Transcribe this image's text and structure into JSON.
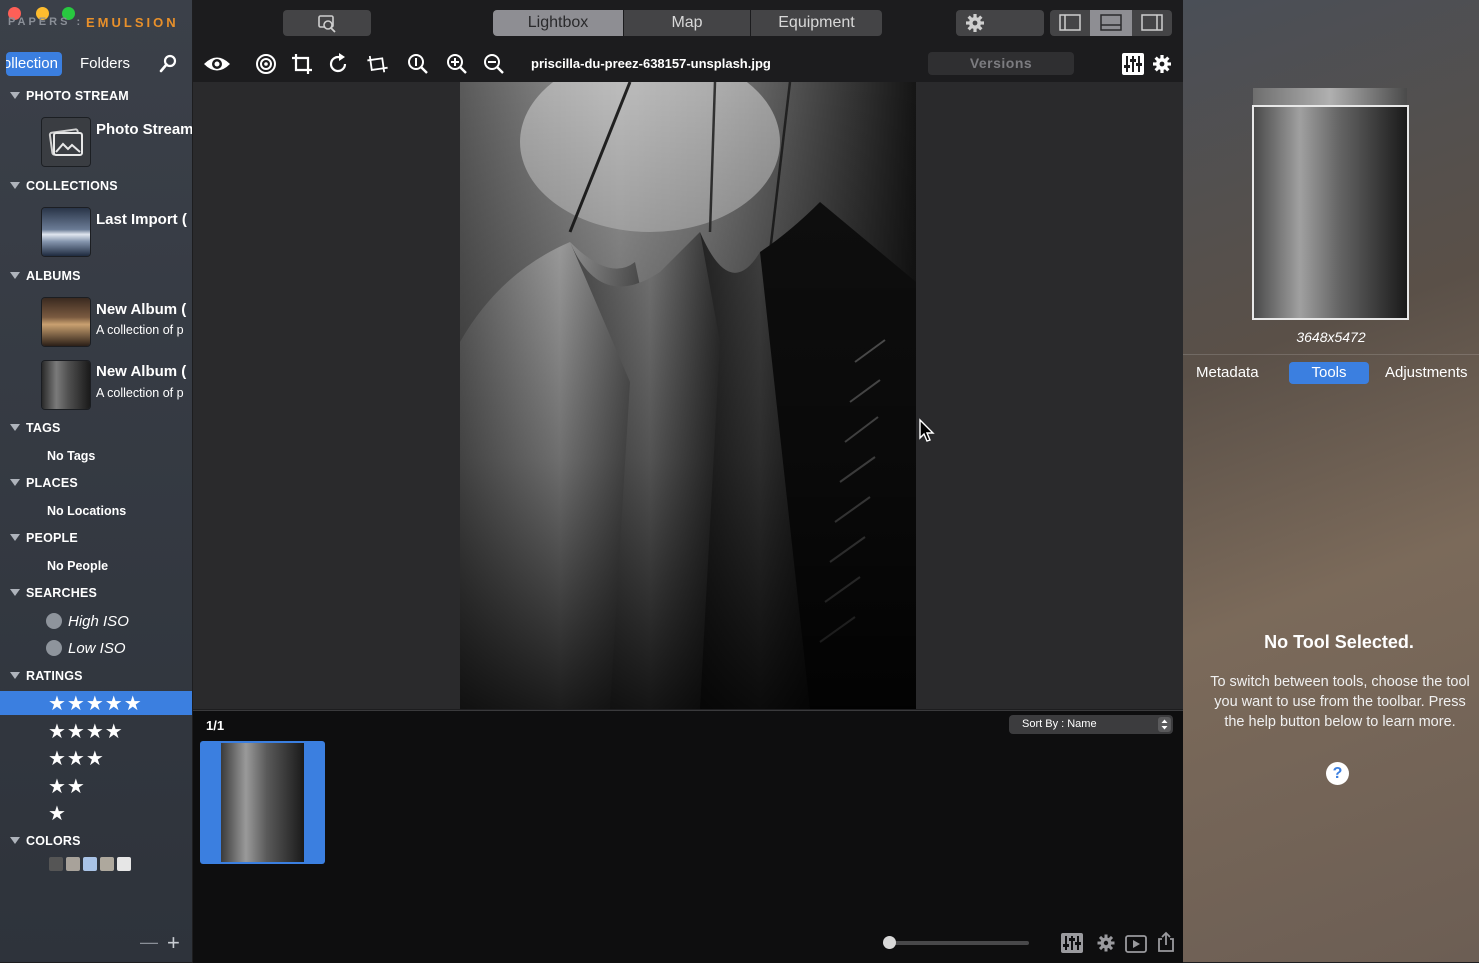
{
  "window": {
    "traffic_lights": [
      "#ff5f57",
      "#febc2e",
      "#28c840"
    ],
    "brand_left": "PAPERS :",
    "brand_right": "EMULSION",
    "accent_color": "#3b7fe0",
    "brand_color": "#e8902a"
  },
  "sidebar": {
    "tabs": {
      "active": "Collection",
      "other": "Folders"
    },
    "search_icon": "magnifier-icon",
    "sections": {
      "photo_stream": "PHOTO STREAM",
      "collections": "COLLECTIONS",
      "albums": "ALBUMS",
      "tags": "TAGS",
      "places": "PLACES",
      "people": "PEOPLE",
      "searches": "SEARCHES",
      "ratings": "RATINGS",
      "colors": "COLORS"
    },
    "photo_stream_item": {
      "title": "Photo Stream"
    },
    "collection_item": {
      "title": "Last Import ("
    },
    "albums": [
      {
        "title": "New Album (",
        "subtitle": "A collection of p"
      },
      {
        "title": "New Album (",
        "subtitle": "A collection of p"
      }
    ],
    "tags_empty": "No Tags",
    "places_empty": "No Locations",
    "people_empty": "No People",
    "searches": [
      "High ISO",
      "Low ISO"
    ],
    "ratings": [
      "★★★★★",
      "★★★★",
      "★★★",
      "★★",
      "★"
    ],
    "ratings_selected": 5,
    "colors": [
      "#555555",
      "#a8a29a",
      "#a9c3e6",
      "#aea89d",
      "#e6e6e6"
    ],
    "bottom": {
      "remove": "—",
      "add": "+"
    }
  },
  "topbar": {
    "segments": [
      "Lightbox",
      "Map",
      "Equipment"
    ],
    "active_segment": "Lightbox"
  },
  "toolbar": {
    "filename": "priscilla-du-preez-638157-unsplash.jpg",
    "versions_label": "Versions",
    "icons": [
      "eye-icon",
      "target-icon",
      "crop-icon",
      "rotate-icon",
      "straighten-icon",
      "zoom-actual-icon",
      "zoom-in-icon",
      "zoom-out-icon",
      "adjust-sliders-icon",
      "gear-icon"
    ]
  },
  "filmstrip": {
    "count": "1/1",
    "sort_label": "Sort By : Name",
    "zoom_value": 0.04
  },
  "rightpanel": {
    "dimensions": "3648x5472",
    "tabs": [
      "Metadata",
      "Tools",
      "Adjustments"
    ],
    "active_tab": "Tools",
    "no_tool_title": "No Tool Selected.",
    "no_tool_help": "To switch between tools, choose the tool you want to use from the toolbar. Press the help button below to learn more.",
    "help_label": "?"
  }
}
